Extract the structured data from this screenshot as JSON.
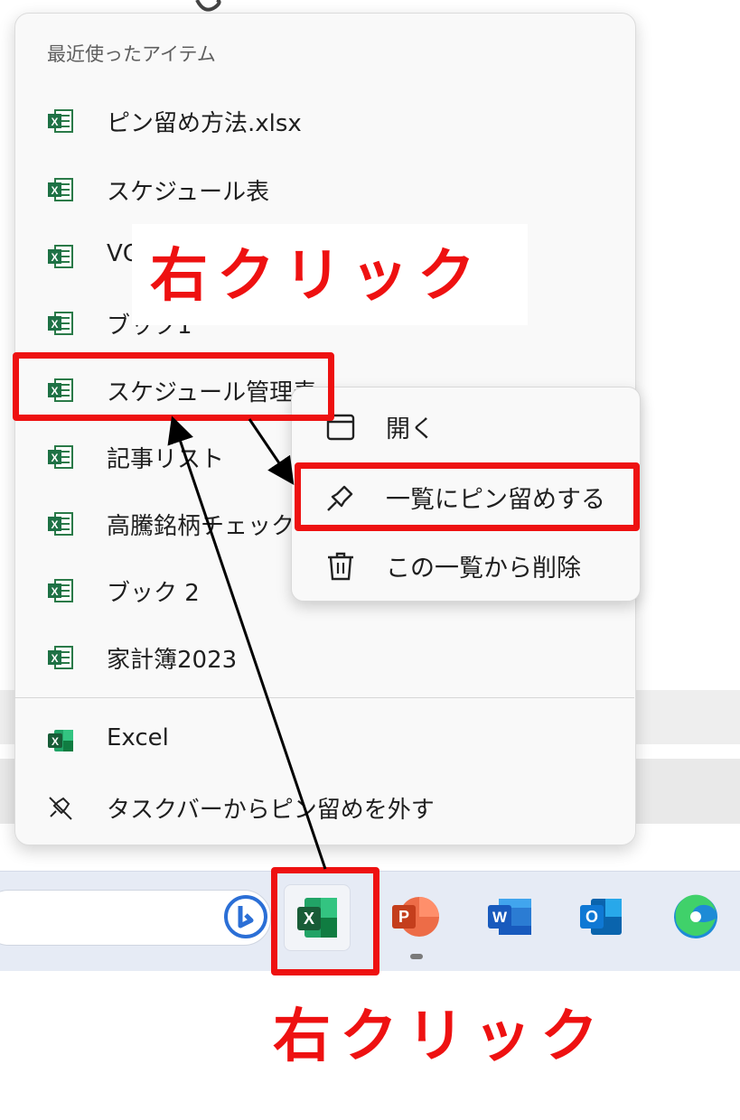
{
  "jumplist": {
    "section_title": "最近使ったアイテム",
    "recent_items": [
      {
        "label": "ピン留め方法.xlsx"
      },
      {
        "label": "スケジュール表"
      },
      {
        "label": "VC"
      },
      {
        "label": "ブック1"
      },
      {
        "label": "スケジュール管理表"
      },
      {
        "label": "記事リスト"
      },
      {
        "label": "高騰銘柄チェック"
      },
      {
        "label": "ブック 2"
      },
      {
        "label": "家計簿2023"
      }
    ],
    "app_item": {
      "label": "Excel",
      "icon": "excel-icon"
    },
    "unpin_item": {
      "label": "タスクバーからピン留めを外す",
      "icon": "unpin-icon"
    }
  },
  "context_menu": {
    "items": [
      {
        "label": "開く",
        "icon": "window-icon"
      },
      {
        "label": "一覧にピン留めする",
        "icon": "pin-icon"
      },
      {
        "label": "この一覧から削除",
        "icon": "trash-icon"
      }
    ]
  },
  "taskbar": {
    "apps": [
      {
        "name": "Bing",
        "icon": "bing-icon"
      },
      {
        "name": "Excel",
        "icon": "excel-icon",
        "active": true
      },
      {
        "name": "PowerPoint",
        "icon": "powerpoint-icon",
        "running": true
      },
      {
        "name": "Word",
        "icon": "word-icon"
      },
      {
        "name": "Outlook",
        "icon": "outlook-icon"
      },
      {
        "name": "Edge",
        "icon": "edge-icon"
      }
    ]
  },
  "annotations": {
    "callout_top": "右クリック",
    "callout_bottom": "右クリック",
    "highlight_color": "#ee1111"
  }
}
